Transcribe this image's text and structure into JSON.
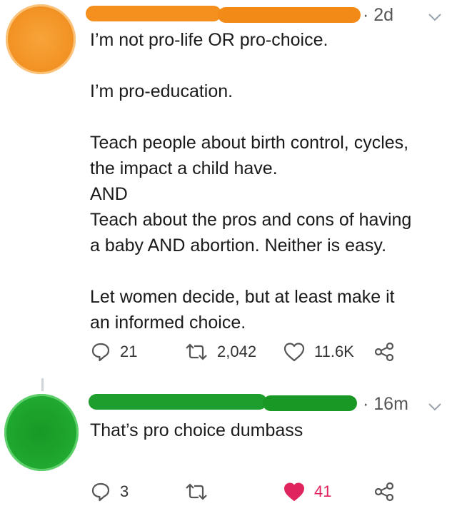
{
  "original_tweet": {
    "author_name_redacted": true,
    "timestamp": "· 2d",
    "paragraphs": [
      [
        "I’m not pro-life OR pro-choice."
      ],
      [
        "I’m pro-education."
      ],
      [
        "Teach people about birth control, cycles,",
        "the impact a child have.",
        "AND",
        "Teach about the pros and cons of having",
        "a baby AND abortion. Neither is easy."
      ],
      [
        "Let women decide, but at least make it",
        "an informed choice."
      ]
    ],
    "actions": {
      "replies": "21",
      "retweets": "2,042",
      "likes": "11.6K",
      "liked": false
    },
    "redaction_color": "#f5901e"
  },
  "reply_tweet": {
    "author_name_redacted": true,
    "timestamp": "· 16m",
    "text": "That’s pro choice dumbass",
    "actions": {
      "replies": "3",
      "retweets": "",
      "likes": "41",
      "liked": true
    },
    "redaction_color": "#1e9e2c"
  },
  "colors": {
    "like_active": "#e0245e",
    "icon_gray": "#555555",
    "thread_line": "#cfd4d9"
  },
  "icons": {
    "reply": "speech-bubble-icon",
    "retweet": "retweet-arrows-icon",
    "like": "heart-icon",
    "share": "share-nodes-icon",
    "menu": "chevron-down-icon"
  }
}
